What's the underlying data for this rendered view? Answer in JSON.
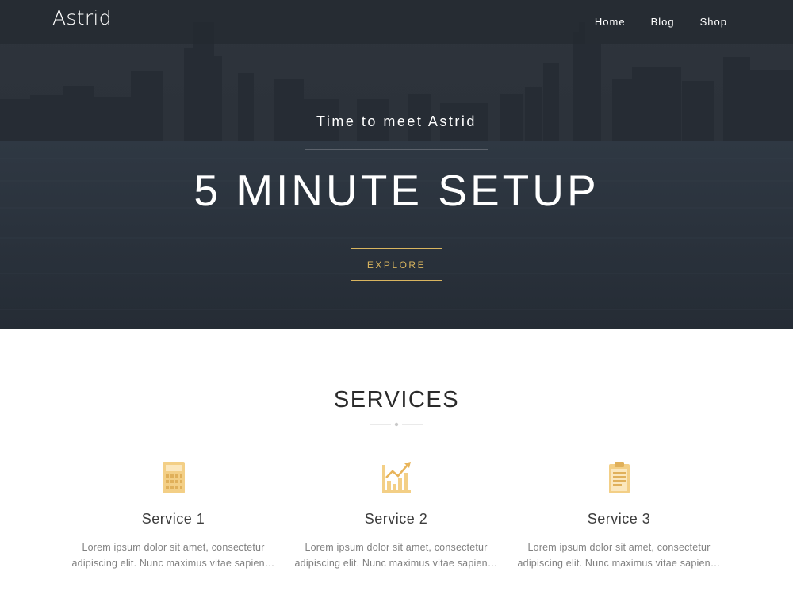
{
  "header": {
    "logo": "Astrid",
    "nav": [
      {
        "label": "Home"
      },
      {
        "label": "Blog"
      },
      {
        "label": "Shop"
      }
    ]
  },
  "hero": {
    "tagline": "Time to meet Astrid",
    "headline": "5 MINUTE SETUP",
    "button_label": "EXPLORE"
  },
  "services": {
    "title": "SERVICES",
    "items": [
      {
        "icon": "calculator-icon",
        "title": "Service 1",
        "text_line1": "Lorem ipsum dolor sit amet, consectetur",
        "text_line2": "adipiscing elit. Nunc maximus vitae sapien…"
      },
      {
        "icon": "growth-chart-icon",
        "title": "Service 2",
        "text_line1": "Lorem ipsum dolor sit amet, consectetur",
        "text_line2": "adipiscing elit. Nunc maximus vitae sapien…"
      },
      {
        "icon": "clipboard-icon",
        "title": "Service 3",
        "text_line1": "Lorem ipsum dolor sit amet, consectetur",
        "text_line2": "adipiscing elit. Nunc maximus vitae sapien…"
      }
    ]
  },
  "colors": {
    "accent": "#d9b55f",
    "hero_bg": "#2c323a",
    "text_dark": "#2b2b2b",
    "text_muted": "#808080"
  }
}
